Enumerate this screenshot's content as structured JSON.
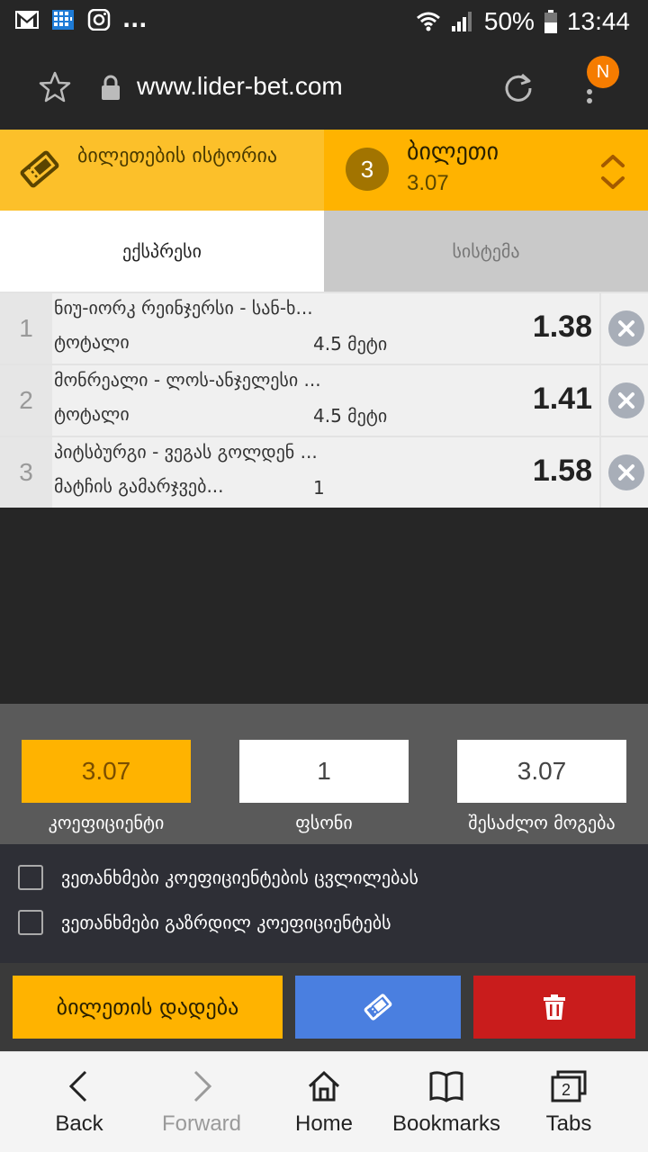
{
  "status_bar": {
    "battery": "50%",
    "time": "13:44",
    "more": "..."
  },
  "browser": {
    "url": "www.lider-bet.com",
    "profile_initial": "N"
  },
  "ticket_header": {
    "history_label": "ბილეთების ისტორია",
    "ticket_count": "3",
    "ticket_title": "ბილეთი",
    "ticket_odds": "3.07"
  },
  "tabs": [
    {
      "label": "ექსპრესი",
      "active": true
    },
    {
      "label": "სისტემა",
      "active": false
    }
  ],
  "bets": [
    {
      "num": "1",
      "match": "ნიუ-იორკ რეინჯერსი - სან-ხ...",
      "market": "ტოტალი",
      "pick": "4.5 მეტი",
      "odds": "1.38"
    },
    {
      "num": "2",
      "match": "მონრეალი - ლოს-ანჯელესი ...",
      "market": "ტოტალი",
      "pick": "4.5 მეტი",
      "odds": "1.41"
    },
    {
      "num": "3",
      "match": "პიტსბურგი - ვეგას გოლდენ ...",
      "market": "მატჩის გამარჯვებ...",
      "pick": "1",
      "odds": "1.58"
    }
  ],
  "summary": {
    "coefficient": "3.07",
    "stake": "1",
    "possible_win": "3.07",
    "coefficient_label": "კოეფიციენტი",
    "stake_label": "ფსონი",
    "possible_win_label": "შესაძლო მოგება"
  },
  "agreements": [
    "ვეთანხმები კოეფიციენტების ცვლილებას",
    "ვეთანხმები გაზრდილ კოეფიციენტებს"
  ],
  "actions": {
    "place_bet": "ბილეთის დადება"
  },
  "bottom_nav": [
    {
      "label": "Back",
      "icon": "back-icon",
      "enabled": true
    },
    {
      "label": "Forward",
      "icon": "forward-icon",
      "enabled": false
    },
    {
      "label": "Home",
      "icon": "home-icon",
      "enabled": true
    },
    {
      "label": "Bookmarks",
      "icon": "bookmarks-icon",
      "enabled": true
    },
    {
      "label": "Tabs",
      "icon": "tabs-icon",
      "enabled": true,
      "count": "2"
    }
  ],
  "colors": {
    "accent_yellow": "#ffb300",
    "history_yellow": "#fcc02a",
    "share_blue": "#4a7fe0",
    "delete_red": "#c91c1c"
  }
}
